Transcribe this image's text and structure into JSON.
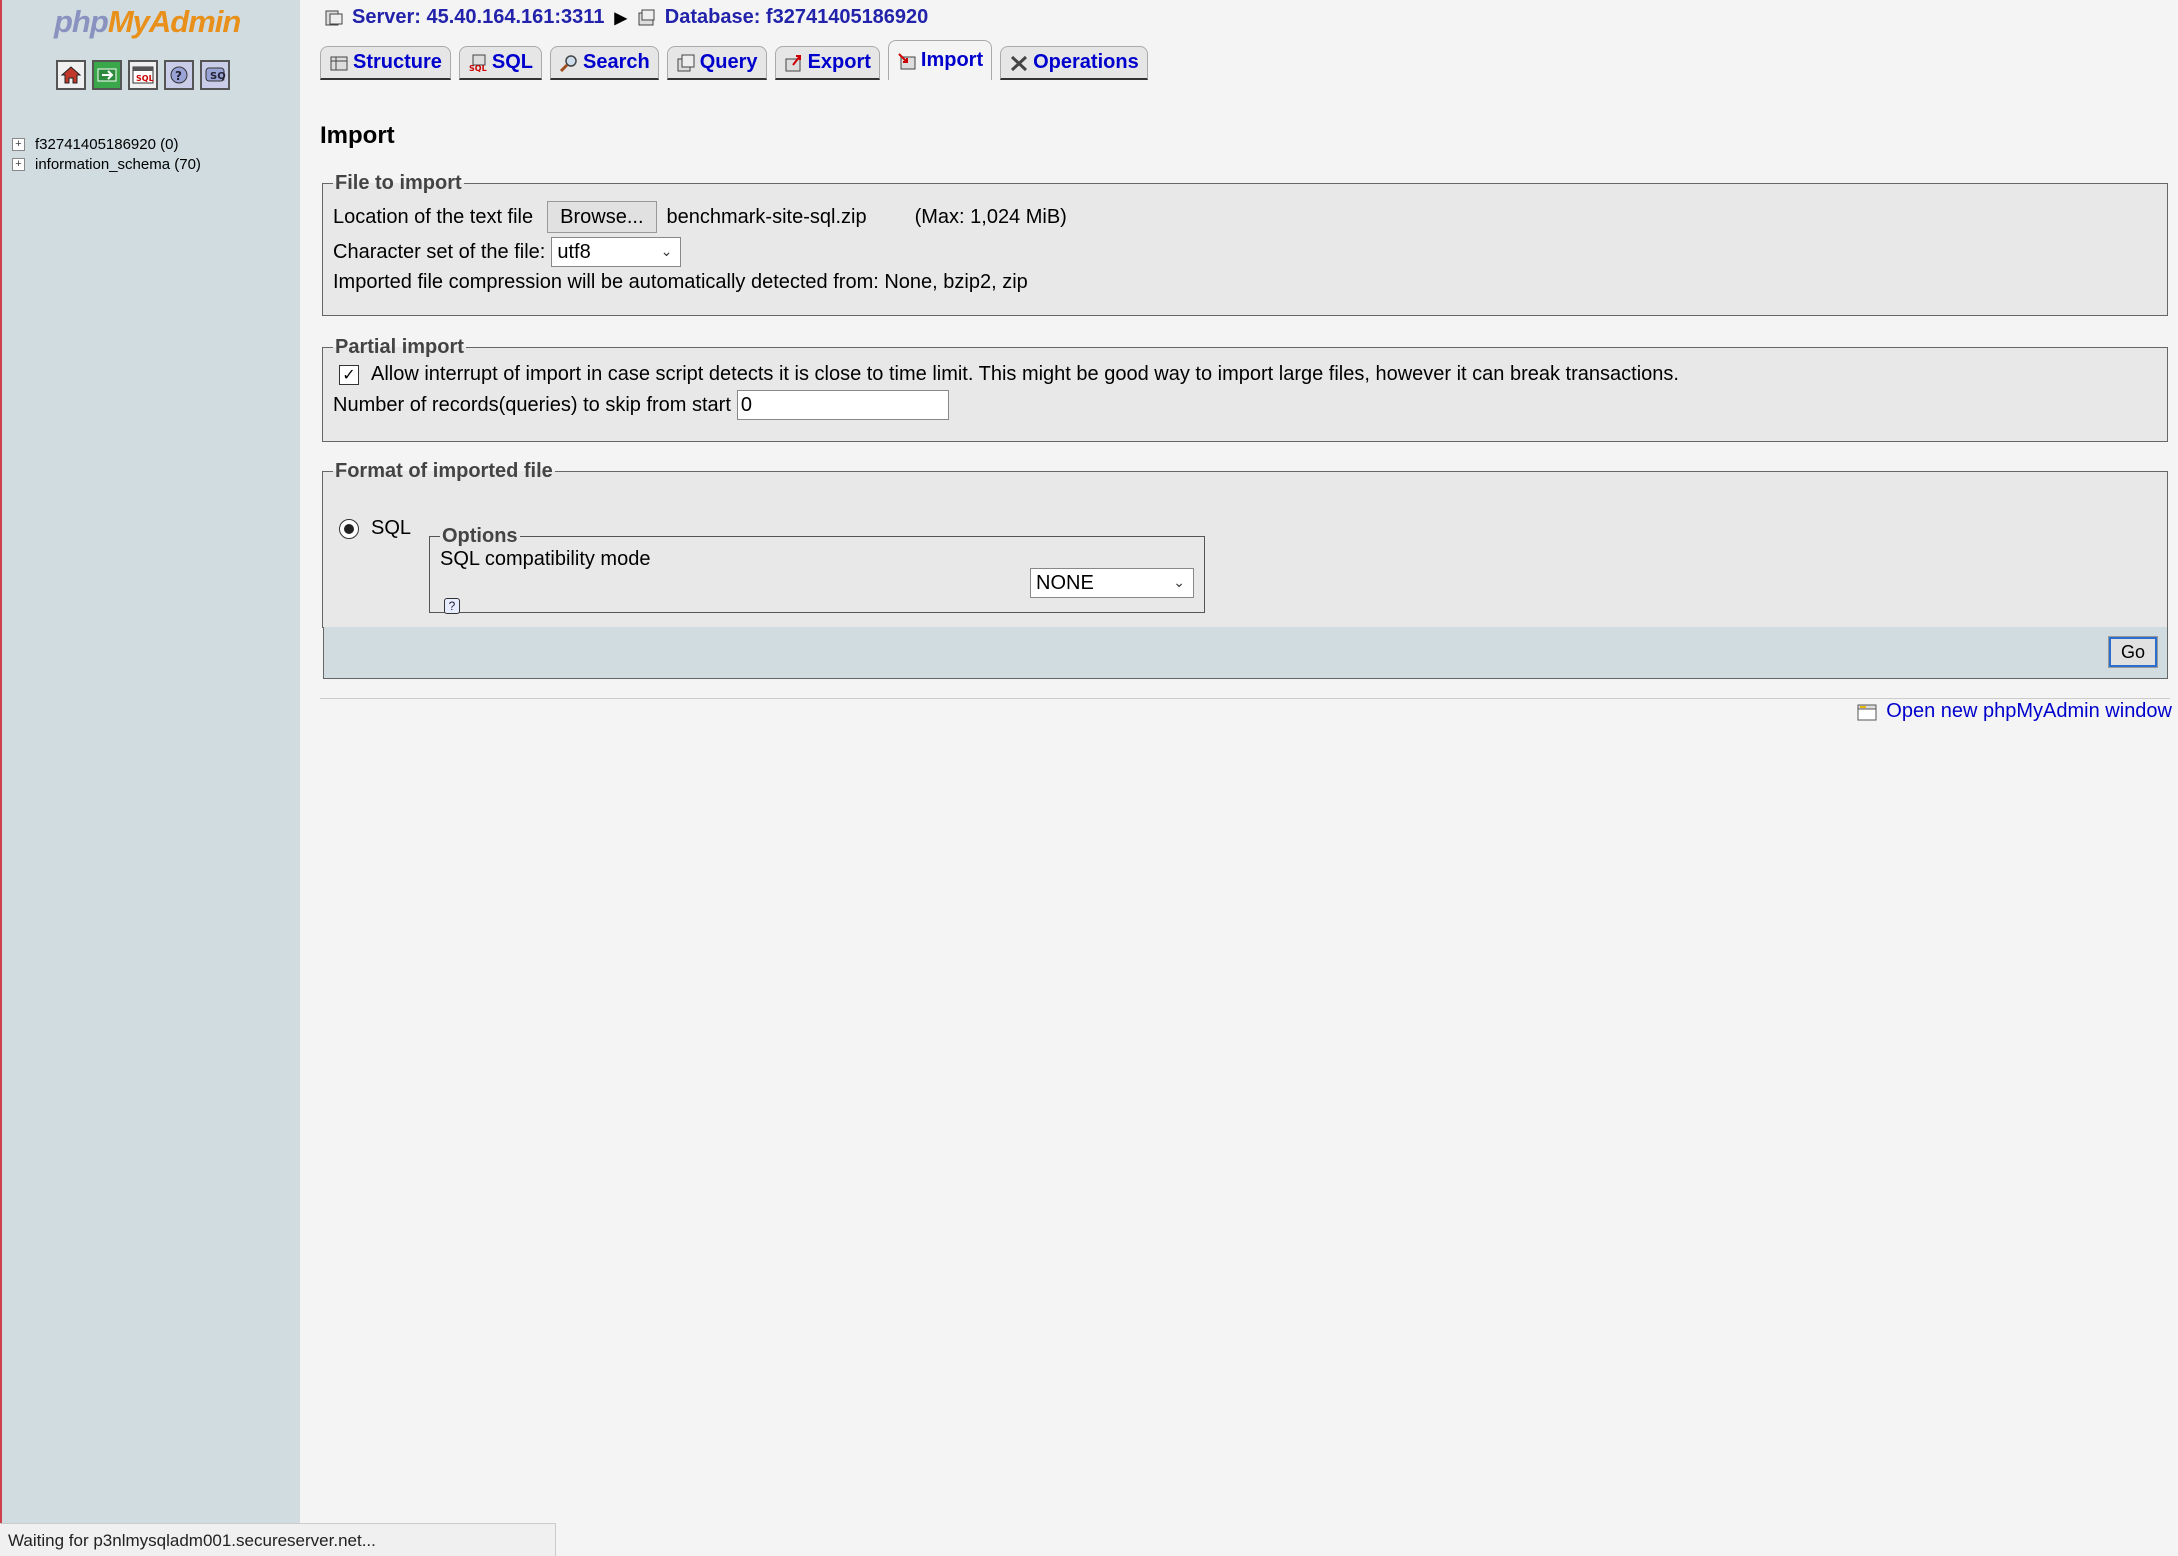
{
  "left": {
    "logo": {
      "php": "php",
      "my": "My",
      "admin": "Admin"
    },
    "icons": [
      "home-icon",
      "exit-icon",
      "sql-query-icon",
      "docs-icon",
      "help-icon"
    ],
    "databases": [
      {
        "label": "f32741405186920 (0)"
      },
      {
        "label": "information_schema (70)"
      }
    ]
  },
  "breadcrumb": {
    "server": "Server: 45.40.164.161:3311",
    "database": "Database: f32741405186920"
  },
  "tabs": [
    {
      "label": "Structure",
      "icon": "structure-icon"
    },
    {
      "label": "SQL",
      "icon": "sql-icon"
    },
    {
      "label": "Search",
      "icon": "search-icon"
    },
    {
      "label": "Query",
      "icon": "query-icon"
    },
    {
      "label": "Export",
      "icon": "export-icon"
    },
    {
      "label": "Import",
      "icon": "import-icon",
      "active": true
    },
    {
      "label": "Operations",
      "icon": "operations-icon"
    }
  ],
  "page_title": "Import",
  "file_to_import": {
    "legend": "File to import",
    "location_label": "Location of the text file",
    "browse_label": "Browse...",
    "file_name": "benchmark-site-sql.zip",
    "max_size": "(Max: 1,024 MiB)",
    "charset_label": "Character set of the file:",
    "charset_value": "utf8",
    "compression_note": "Imported file compression will be automatically detected from: None, bzip2, zip"
  },
  "partial_import": {
    "legend": "Partial import",
    "allow_interrupt_label": "Allow interrupt of import in case script detects it is close to time limit. This might be good way to import large files, however it can break transactions.",
    "allow_interrupt_checked": true,
    "skip_label": "Number of records(queries) to skip from start",
    "skip_value": "0"
  },
  "format": {
    "legend": "Format of imported file",
    "sql_label": "SQL",
    "options_legend": "Options",
    "compat_label": "SQL compatibility mode",
    "compat_value": "NONE"
  },
  "go_label": "Go",
  "open_new_window": "Open new phpMyAdmin window",
  "status_bar": "Waiting for p3nlmysqladm001.secureserver.net..."
}
